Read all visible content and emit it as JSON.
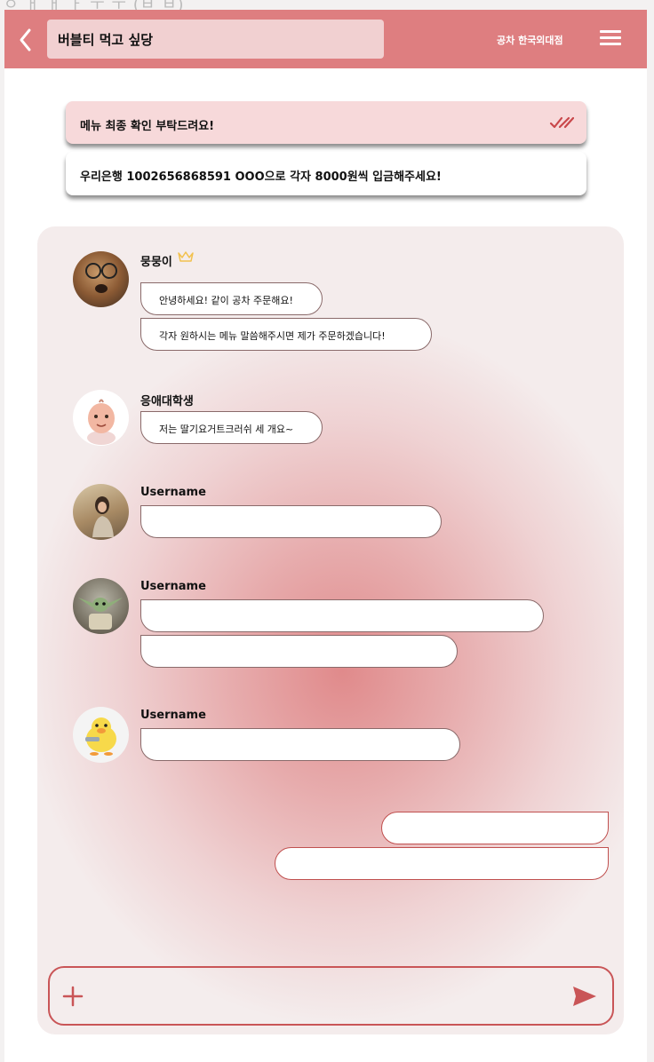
{
  "header": {
    "room_title": "버블티 먹고 싶당",
    "store_name": "공차 한국외대점"
  },
  "notices": [
    {
      "text": "메뉴 최종 확인 부탁드려요!"
    },
    {
      "text": "우리은행 1002656868591 OOO으로 각자 8000원씩 입금해주세요!"
    }
  ],
  "messages": [
    {
      "username": "뭉뭉이",
      "is_leader": true,
      "bubbles": [
        "안녕하세요! 같이 공차 주문해요!",
        "각자 원하시는 메뉴 말씀해주시면 제가 주문하겠습니다!"
      ]
    },
    {
      "username": "응애대학생",
      "bubbles": [
        "저는 딸기요거트크러쉬 세 개요~"
      ]
    },
    {
      "username": "Username",
      "bubbles": [
        ""
      ]
    },
    {
      "username": "Username",
      "bubbles": [
        "",
        ""
      ]
    },
    {
      "username": "Username",
      "bubbles": [
        ""
      ]
    }
  ],
  "my_messages": [
    "",
    ""
  ],
  "colors": {
    "header": "#de7e80",
    "accent": "#c95557",
    "notice_highlight": "#f7d9da"
  },
  "icons": {
    "back": "chevron-left-icon",
    "menu": "hamburger-menu-icon",
    "read": "double-check-icon",
    "leader": "crown-icon",
    "attach": "plus-icon",
    "send": "send-icon"
  }
}
